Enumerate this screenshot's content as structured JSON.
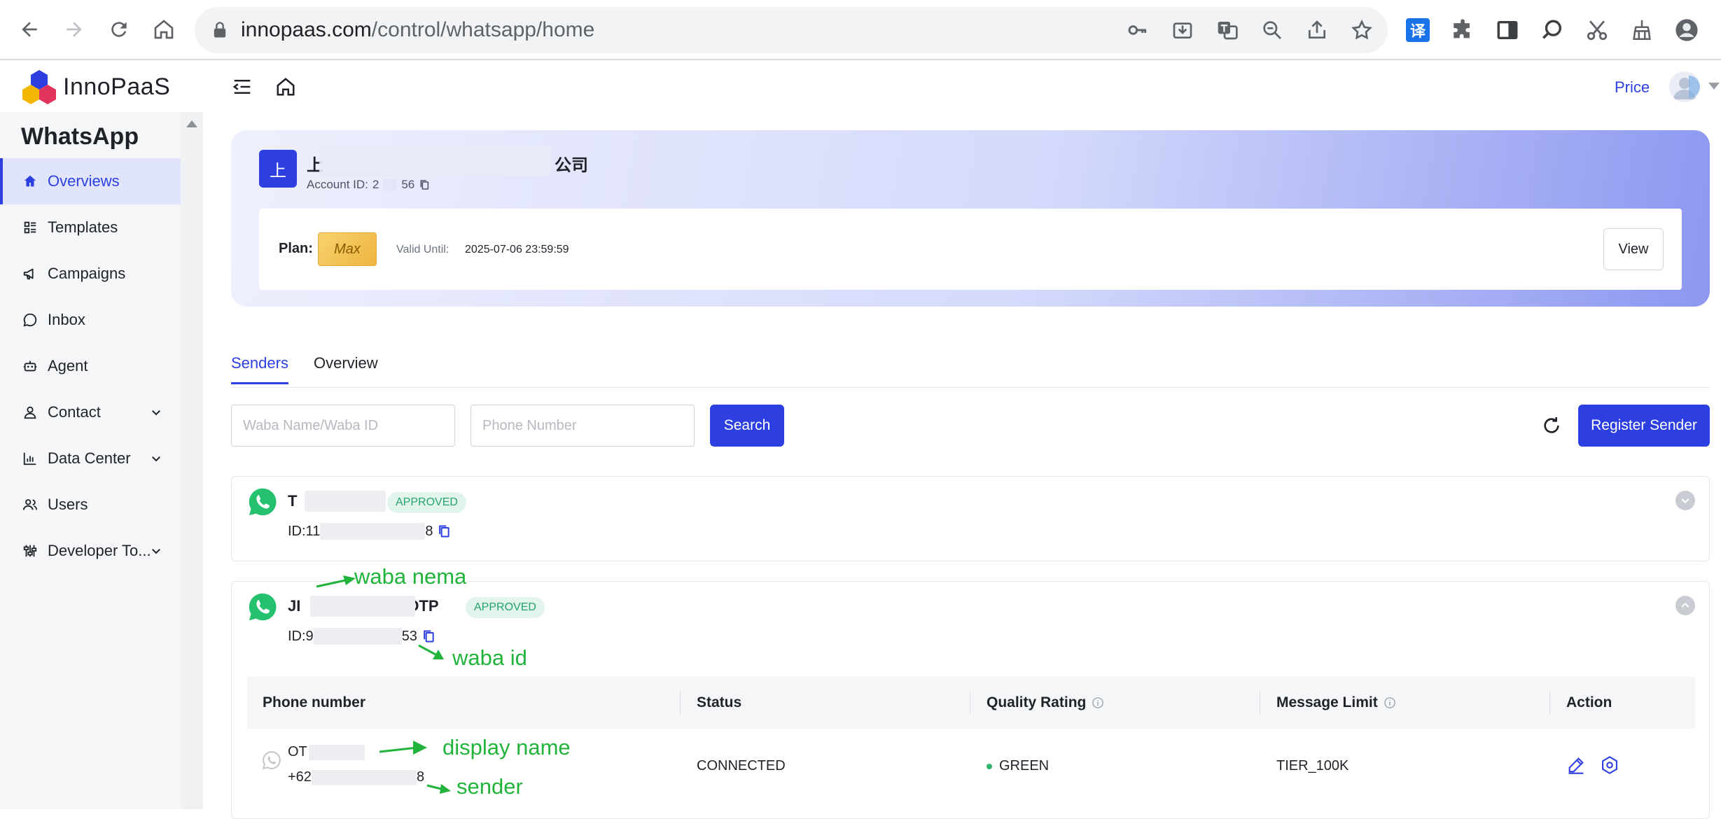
{
  "browser": {
    "url_host": "innopaas.com",
    "url_path": "/control/whatsapp/home"
  },
  "header": {
    "logo_text": "InnoPaaS",
    "price_label": "Price"
  },
  "sidebar": {
    "title": "WhatsApp",
    "items": [
      {
        "label": "Overviews",
        "icon": "home-icon",
        "active": true
      },
      {
        "label": "Templates",
        "icon": "template-icon"
      },
      {
        "label": "Campaigns",
        "icon": "megaphone-icon"
      },
      {
        "label": "Inbox",
        "icon": "chat-icon"
      },
      {
        "label": "Agent",
        "icon": "robot-icon"
      },
      {
        "label": "Contact",
        "icon": "person-icon",
        "expandable": true
      },
      {
        "label": "Data Center",
        "icon": "chart-icon",
        "expandable": true
      },
      {
        "label": "Users",
        "icon": "users-icon"
      },
      {
        "label": "Developer To...",
        "icon": "tools-icon",
        "expandable": true
      }
    ]
  },
  "account": {
    "badge": "上",
    "name_start": "上",
    "name_end": "公司",
    "id_label": "Account ID:",
    "id_start": "2",
    "id_end": "56",
    "plan_label": "Plan:",
    "plan_value": "Max",
    "valid_label": "Valid Until:",
    "valid_value": "2025-07-06 23:59:59",
    "view_label": "View"
  },
  "tabs": [
    {
      "label": "Senders",
      "active": true
    },
    {
      "label": "Overview"
    }
  ],
  "filters": {
    "waba_placeholder": "Waba Name/Waba ID",
    "phone_placeholder": "Phone Number",
    "search_label": "Search",
    "register_label": "Register Sender"
  },
  "senders": [
    {
      "name_start": "T",
      "name_end": "",
      "status": "APPROVED",
      "id_start": "ID:11",
      "id_end": "8"
    },
    {
      "name_start": "JI",
      "name_end": "OTP",
      "status": "APPROVED",
      "id_start": "ID:9",
      "id_end": "53"
    }
  ],
  "table": {
    "headers": [
      "Phone number",
      "Status",
      "Quality Rating",
      "Message Limit",
      "Action"
    ],
    "row": {
      "display_name": "OT",
      "phone_start": "+62",
      "phone_end": "8",
      "status": "CONNECTED",
      "quality": "GREEN",
      "limit": "TIER_100K"
    }
  },
  "annotations": {
    "waba_name": "waba nema",
    "waba_id": "waba id",
    "display_name": "display name",
    "sender": "sender"
  },
  "colors": {
    "primary": "#2d3fe0",
    "annotation": "#22b33c",
    "approved_text": "#25a36b",
    "whatsapp": "#25c16f"
  }
}
